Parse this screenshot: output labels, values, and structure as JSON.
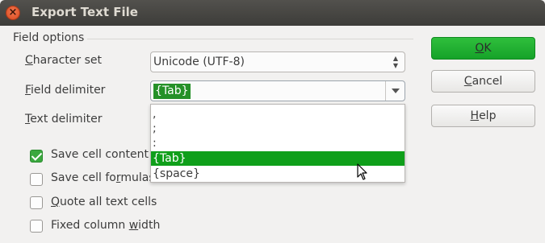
{
  "window": {
    "title": "Export Text File"
  },
  "field_options": {
    "section_label": "Field options",
    "character_set": {
      "label_pre": "",
      "label_u": "C",
      "label_post": "haracter set",
      "value": "Unicode (UTF-8)"
    },
    "field_delimiter": {
      "label_pre": "",
      "label_u": "F",
      "label_post": "ield delimiter",
      "value": "{Tab}"
    },
    "text_delimiter": {
      "label_pre": "",
      "label_u": "T",
      "label_post": "ext delimiter"
    }
  },
  "dropdown": {
    "options": [
      ",",
      ";",
      ":",
      "{Tab}",
      "{space}"
    ],
    "selected_index": 3
  },
  "checkboxes": [
    {
      "pre": "Save cell content as",
      "u": "",
      "post": "",
      "checked": true
    },
    {
      "pre": "Save cell fo",
      "u": "r",
      "post": "mulas",
      "checked": false
    },
    {
      "pre": "",
      "u": "Q",
      "post": "uote all text cells",
      "checked": false
    },
    {
      "pre": "Fixed column ",
      "u": "w",
      "post": "idth",
      "checked": false
    }
  ],
  "buttons": {
    "ok": {
      "pre": "",
      "u": "O",
      "post": "K"
    },
    "cancel": {
      "pre": "",
      "u": "C",
      "post": "ancel"
    },
    "help": {
      "pre": "",
      "u": "H",
      "post": "elp"
    }
  },
  "colors": {
    "accent": "#0f9f1a",
    "titlebar": "#3d3c39",
    "close": "#e3572b"
  }
}
